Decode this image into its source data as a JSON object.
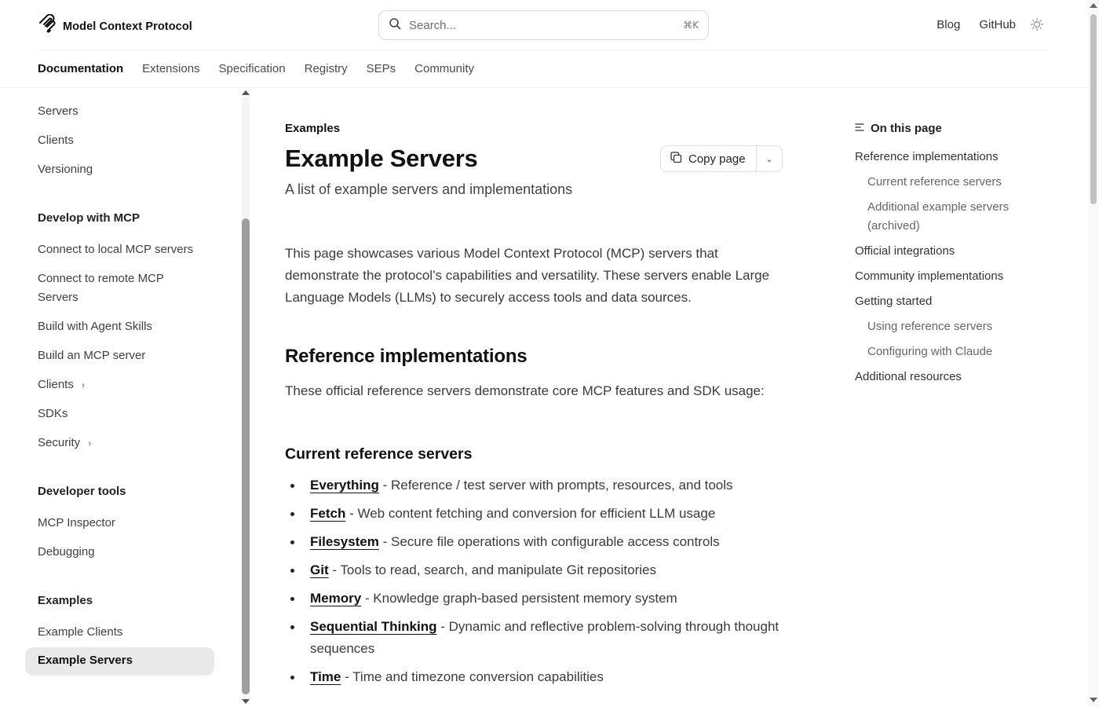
{
  "header": {
    "brand": "Model Context Protocol",
    "logo_icon": "mcp-logo-icon",
    "search": {
      "placeholder": "Search...",
      "shortcut": "⌘K"
    },
    "links": [
      "Blog",
      "GitHub"
    ],
    "theme_icon": "sun-icon"
  },
  "tabs": [
    {
      "label": "Documentation",
      "active": true
    },
    {
      "label": "Extensions"
    },
    {
      "label": "Specification"
    },
    {
      "label": "Registry"
    },
    {
      "label": "SEPs"
    },
    {
      "label": "Community"
    }
  ],
  "sidebar": {
    "top_items": [
      "Servers",
      "Clients",
      "Versioning"
    ],
    "sections": [
      {
        "title": "Develop with MCP",
        "items": [
          "Connect to local MCP servers",
          "Connect to remote MCP Servers",
          "Build with Agent Skills",
          "Build an MCP server",
          "Clients",
          "SDKs",
          "Security"
        ]
      },
      {
        "title": "Developer tools",
        "items": [
          "MCP Inspector",
          "Debugging"
        ]
      },
      {
        "title": "Examples",
        "items": [
          "Example Clients",
          "Example Servers"
        ]
      }
    ],
    "remote_line1": "Connect to remote MCP",
    "remote_line2": "Servers",
    "active_item": "Example Servers"
  },
  "main": {
    "eyebrow": "Examples",
    "title": "Example Servers",
    "subtitle": "A list of example servers and implementations",
    "copy_button": "Copy page",
    "intro": "This page showcases various Model Context Protocol (MCP) servers that demonstrate the protocol’s capabilities and versatility. These servers enable Large Language Models (LLMs) to securely access tools and data sources.",
    "section_title": "Reference implementations",
    "section_text": "These official reference servers demonstrate core MCP features and SDK usage:",
    "subsection_title": "Current reference servers",
    "servers": [
      {
        "name": "Everything",
        "desc": " - Reference / test server with prompts, resources, and tools"
      },
      {
        "name": "Fetch",
        "desc": " - Web content fetching and conversion for efficient LLM usage"
      },
      {
        "name": "Filesystem",
        "desc": " - Secure file operations with configurable access controls"
      },
      {
        "name": "Git",
        "desc": " - Tools to read, search, and manipulate Git repositories"
      },
      {
        "name": "Memory",
        "desc": " - Knowledge graph-based persistent memory system"
      },
      {
        "name": "Sequential Thinking",
        "desc": " - Dynamic and reflective problem-solving through thought sequences"
      },
      {
        "name": "Time",
        "desc": " - Time and timezone conversion capabilities"
      }
    ]
  },
  "toc": {
    "title": "On this page",
    "items": [
      {
        "label": "Reference implementations",
        "level": 1
      },
      {
        "label": "Current reference servers",
        "level": 2
      },
      {
        "label": "Additional example servers (archived)",
        "level": 2
      },
      {
        "label": "Official integrations",
        "level": 1
      },
      {
        "label": "Community implementations",
        "level": 1
      },
      {
        "label": "Getting started",
        "level": 1
      },
      {
        "label": "Using reference servers",
        "level": 2
      },
      {
        "label": "Configuring with Claude",
        "level": 2
      },
      {
        "label": "Additional resources",
        "level": 1
      }
    ]
  }
}
